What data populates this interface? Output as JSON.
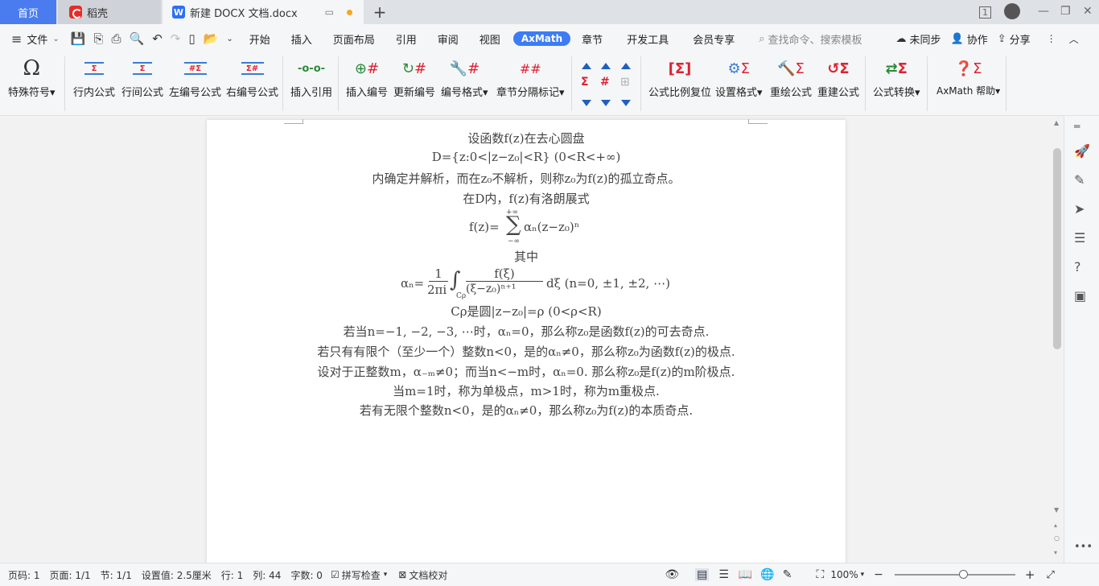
{
  "tabs": {
    "home": "首页",
    "daoke": "稻壳",
    "doc": "新建 DOCX 文档.docx"
  },
  "window": {
    "badge": "1"
  },
  "menu": {
    "file": "文件",
    "items": [
      "开始",
      "插入",
      "页面布局",
      "引用",
      "审阅",
      "视图",
      "AxMath",
      "章节",
      "开发工具",
      "会员专享"
    ],
    "active": "AxMath",
    "search": "查找命令、搜索模板",
    "sync": "未同步",
    "collab": "协作",
    "share": "分享"
  },
  "ribbon": [
    {
      "label": "特殊符号",
      "icon": "omega-icon"
    },
    {
      "label": "行内公式",
      "icon": "inline-formula-icon"
    },
    {
      "label": "行间公式",
      "icon": "display-formula-icon"
    },
    {
      "label": "左编号公式",
      "icon": "left-number-formula-icon"
    },
    {
      "label": "右编号公式",
      "icon": "right-number-formula-icon"
    },
    {
      "label": "插入引用",
      "icon": "insert-reference-icon"
    },
    {
      "label": "插入编号",
      "icon": "insert-number-icon"
    },
    {
      "label": "更新编号",
      "icon": "update-number-icon"
    },
    {
      "label": "编号格式",
      "icon": "number-format-icon"
    },
    {
      "label": "章节分隔标记",
      "icon": "chapter-separator-icon"
    },
    {
      "label": "公式比例复位",
      "icon": "formula-scale-reset-icon"
    },
    {
      "label": "设置格式",
      "icon": "set-format-icon"
    },
    {
      "label": "重绘公式",
      "icon": "redraw-formula-icon"
    },
    {
      "label": "重建公式",
      "icon": "rebuild-formula-icon"
    },
    {
      "label": "公式转换",
      "icon": "formula-convert-icon"
    },
    {
      "label": "AxMath 帮助",
      "icon": "help-icon"
    }
  ],
  "doc": {
    "l1": "设函数f(z)在去心圆盘",
    "l2": "D={z:0<|z−z₀|<R}   (0<R<+∞)",
    "l3": "内确定并解析，而在z₀不解析，则称z₀为f(z)的孤立奇点。",
    "l4": "在D内，f(z)有洛朗展式",
    "l5a": "f(z)=",
    "l5sum": "∑",
    "l5top": "+∞",
    "l5bot": "−∞",
    "l5b": "αₙ(z−z₀)ⁿ",
    "l6": "其中",
    "l7a": "αₙ=",
    "l7num": "1",
    "l7den": "2πi",
    "l7int": "∫",
    "l7sub": "Cρ",
    "l7fnum": "f(ξ)",
    "l7fden": "(ξ−z₀)ⁿ⁺¹",
    "l7b": "dξ   (n=0, ±1, ±2, ⋯)",
    "l8": "Cρ是圆|z−z₀|=ρ   (0<ρ<R)",
    "l9": "若当n=−1, −2, −3, ⋯时，αₙ=0，那么称z₀是函数f(z)的可去奇点.",
    "l10": "若只有有限个（至少一个）整数n<0，是的αₙ≠0，那么称z₀为函数f(z)的极点.",
    "l11": "设对于正整数m，α₋ₘ≠0；而当n<−m时，αₙ=0. 那么称z₀是f(z)的m阶极点.",
    "l12": "当m=1时，称为单极点，m>1时，称为m重极点.",
    "l13": "若有无限个整数n<0，是的αₙ≠0，那么称z₀为f(z)的本质奇点."
  },
  "status": {
    "pagecode": "页码: 1",
    "page": "页面: 1/1",
    "section": "节: 1/1",
    "setting": "设置值: 2.5厘米",
    "row": "行: 1",
    "col": "列: 44",
    "words": "字数: 0",
    "spell": "拼写检查",
    "proof": "文档校对",
    "zoom": "100%"
  }
}
